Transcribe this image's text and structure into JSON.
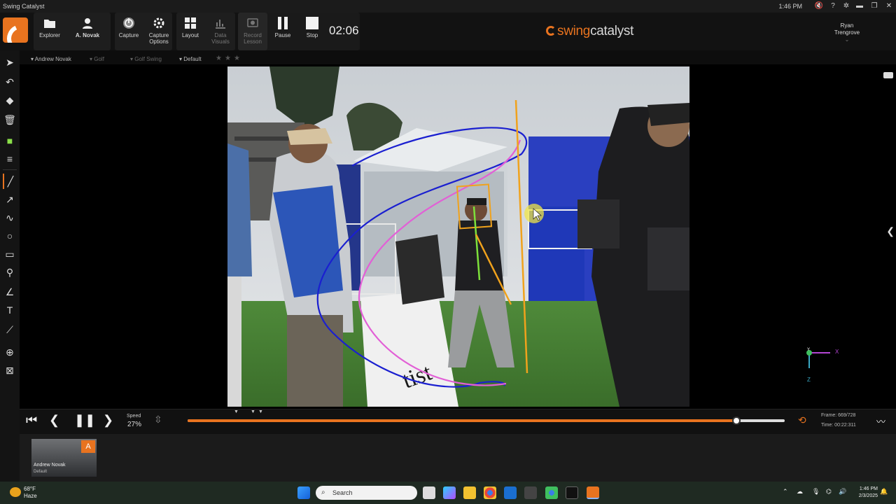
{
  "window": {
    "title": "Swing Catalyst",
    "clock": "1:46 PM",
    "icons": [
      "mute-icon",
      "help-icon",
      "settings-icon",
      "minimize-icon",
      "restore-icon",
      "close-icon"
    ]
  },
  "toolbar": {
    "explorer": "Explorer",
    "user_label": "A. Novak",
    "capture": "Capture",
    "capture_options_1": "Capture",
    "capture_options_2": "Options",
    "layout": "Layout",
    "data_visuals_1": "Data",
    "data_visuals_2": "Visuals",
    "record_lesson_1": "Record",
    "record_lesson_2": "Lesson",
    "pause": "Pause",
    "stop": "Stop",
    "timer": "02:06",
    "brand_swing": "swing",
    "brand_catalyst": "catalyst",
    "user_first": "Ryan",
    "user_last": "Trengrove"
  },
  "breadcrumb": {
    "player": "Andrew Novak",
    "sport": "Golf",
    "category": "Golf Swing",
    "view": "Default"
  },
  "axis": {
    "y": "Y",
    "x": "X",
    "z": "Z"
  },
  "playback": {
    "speed_label": "Speed",
    "speed_value": "27%",
    "frame": "Frame: 669/728",
    "time": "Time: 00:22:311",
    "progress": 0.919
  },
  "thumbnail": {
    "badge": "A",
    "name": "Andrew Novak",
    "sub": "Default"
  },
  "taskbar": {
    "temp": "68°F",
    "condition": "Haze",
    "search_placeholder": "Search",
    "time": "1:46 PM",
    "date": "2/3/2025"
  },
  "colors": {
    "accent": "#e8731f",
    "blue_line": "#1a1fd0",
    "pink_line": "#e25fd6",
    "yellow_line": "#f0a21c",
    "green_line": "#7de13b"
  }
}
